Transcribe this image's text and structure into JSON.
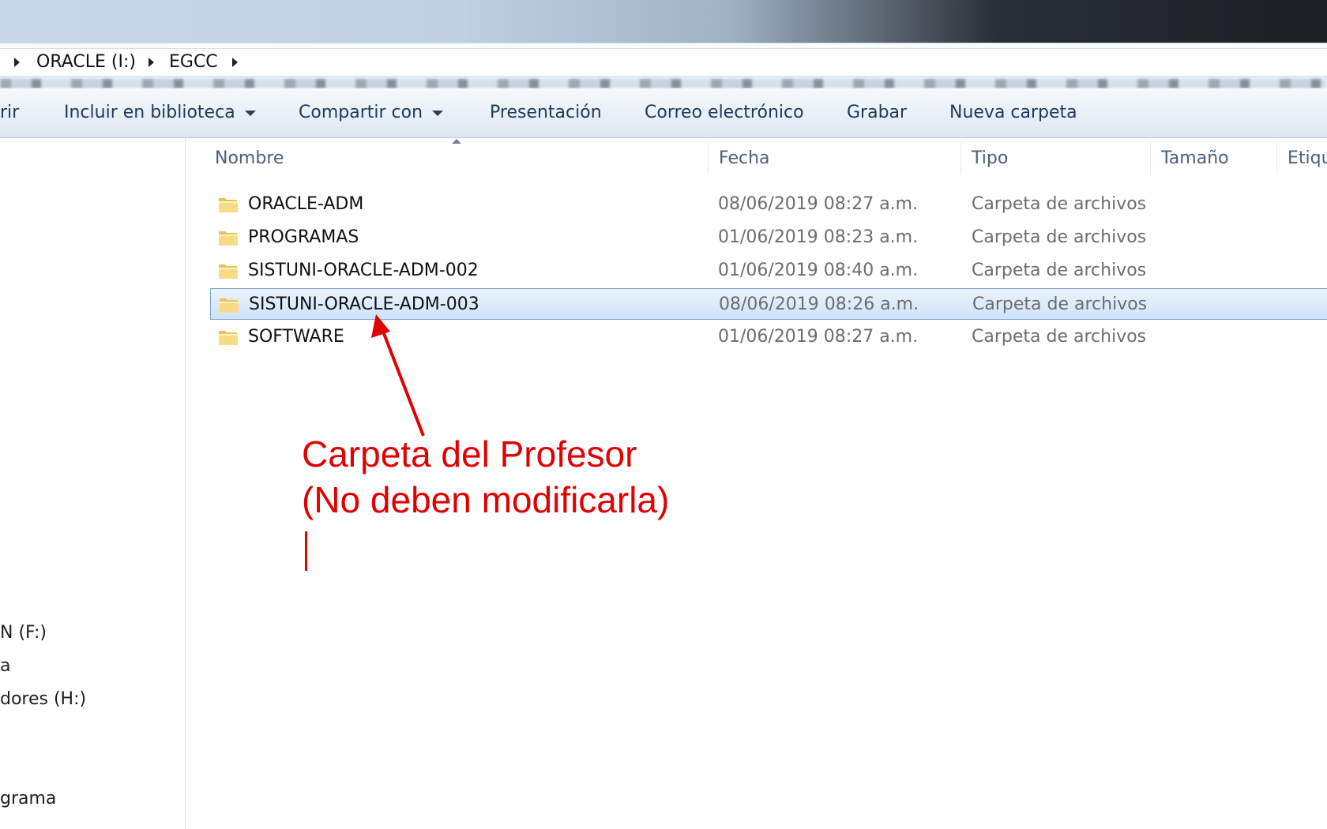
{
  "address": {
    "crumbs": [
      "ORACLE (I:)",
      "EGCC"
    ]
  },
  "toolbar": {
    "items": [
      "rir",
      "Incluir en biblioteca",
      "Compartir con",
      "Presentación",
      "Correo electrónico",
      "Grabar",
      "Nueva carpeta"
    ]
  },
  "navpane": {
    "items": [
      "N (F:)",
      "a",
      "dores (H:)",
      "grama"
    ]
  },
  "list": {
    "columns": [
      "Nombre",
      "Fecha",
      "Tipo",
      "Tamaño",
      "Etiqu"
    ],
    "rows": [
      {
        "name": "ORACLE-ADM",
        "date": "08/06/2019 08:27 a.m.",
        "type": "Carpeta de archivos"
      },
      {
        "name": "PROGRAMAS",
        "date": "01/06/2019 08:23 a.m.",
        "type": "Carpeta de archivos"
      },
      {
        "name": "SISTUNI-ORACLE-ADM-002",
        "date": "01/06/2019 08:40 a.m.",
        "type": "Carpeta de archivos"
      },
      {
        "name": "SISTUNI-ORACLE-ADM-003",
        "date": "08/06/2019 08:26 a.m.",
        "type": "Carpeta de archivos"
      },
      {
        "name": "SOFTWARE",
        "date": "01/06/2019 08:27 a.m.",
        "type": "Carpeta de archivos"
      }
    ],
    "selected_row": "SISTUNI-ORACLE-ADM-003"
  },
  "annotation": {
    "line1": "Carpeta del Profesor",
    "line2": "(No deben modificarla)",
    "color": "#e00000"
  }
}
